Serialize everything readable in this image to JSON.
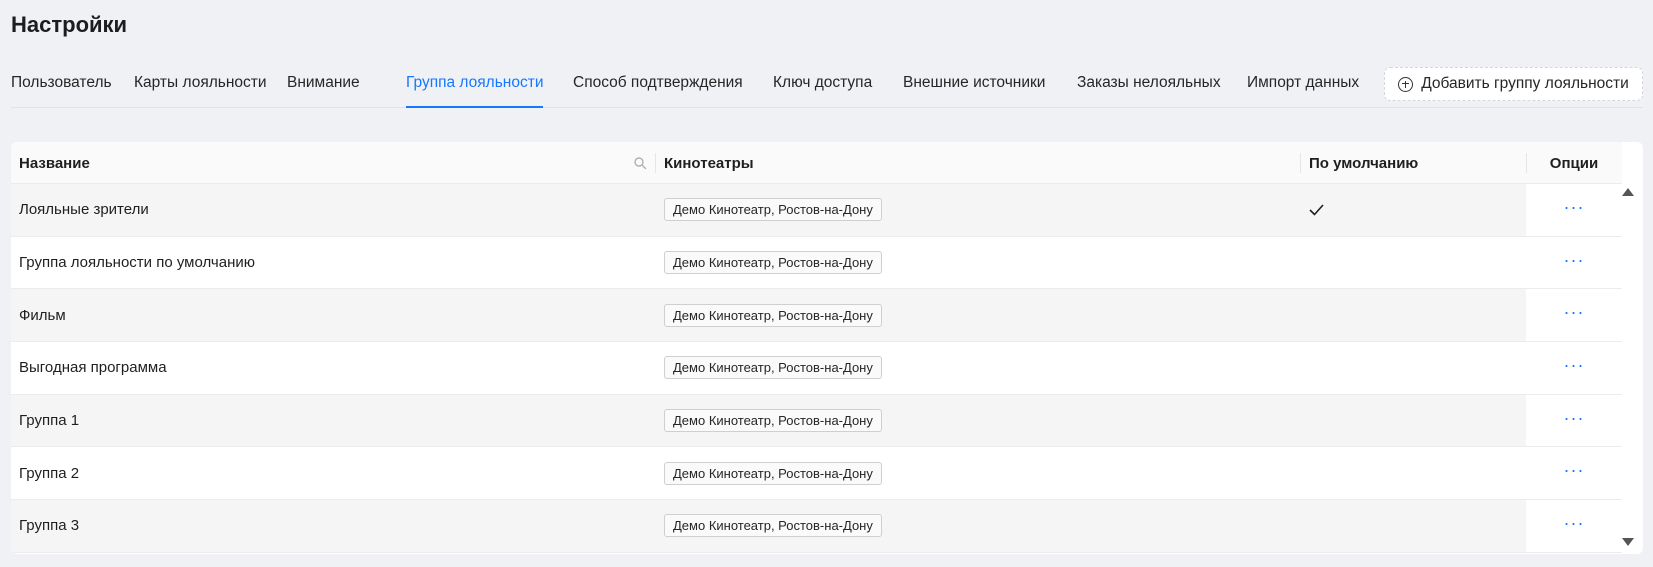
{
  "page": {
    "title": "Настройки"
  },
  "tabs": [
    {
      "label": "Пользователь",
      "active": false
    },
    {
      "label": "Карты лояльности",
      "active": false
    },
    {
      "label": "Внимание",
      "active": false
    },
    {
      "label": "Группа лояльности",
      "active": true
    },
    {
      "label": "Способ подтверждения",
      "active": false
    },
    {
      "label": "Ключ доступа",
      "active": false
    },
    {
      "label": "Внешние источники",
      "active": false
    },
    {
      "label": "Заказы нелояльных",
      "active": false
    },
    {
      "label": "Импорт данных",
      "active": false
    }
  ],
  "actions": {
    "add_label": "Добавить группу лояльности",
    "add_icon": "plus-circle-icon"
  },
  "table": {
    "columns": {
      "name": "Название",
      "cinemas": "Кинотеатры",
      "default": "По умолчанию",
      "options": "Опции"
    },
    "rows": [
      {
        "name": "Лояльные зрители",
        "cinema": "Демо Кинотеатр, Ростов-на-Дону",
        "is_default": true,
        "options": "···"
      },
      {
        "name": "Группа лояльности по умолчанию",
        "cinema": "Демо Кинотеатр, Ростов-на-Дону",
        "is_default": false,
        "options": "···"
      },
      {
        "name": "Фильм",
        "cinema": "Демо Кинотеатр, Ростов-на-Дону",
        "is_default": false,
        "options": "···"
      },
      {
        "name": "Выгодная программа",
        "cinema": "Демо Кинотеатр, Ростов-на-Дону",
        "is_default": false,
        "options": "···"
      },
      {
        "name": "Группа 1",
        "cinema": "Демо Кинотеатр, Ростов-на-Дону",
        "is_default": false,
        "options": "···"
      },
      {
        "name": "Группа 2",
        "cinema": "Демо Кинотеатр, Ростов-на-Дону",
        "is_default": false,
        "options": "···"
      },
      {
        "name": "Группа 3",
        "cinema": "Демо Кинотеатр, Ростов-на-Дону",
        "is_default": false,
        "options": "···"
      }
    ]
  },
  "colors": {
    "accent": "#1677ff",
    "background": "#f0f1f5",
    "row_alt": "#f5f5f5"
  }
}
